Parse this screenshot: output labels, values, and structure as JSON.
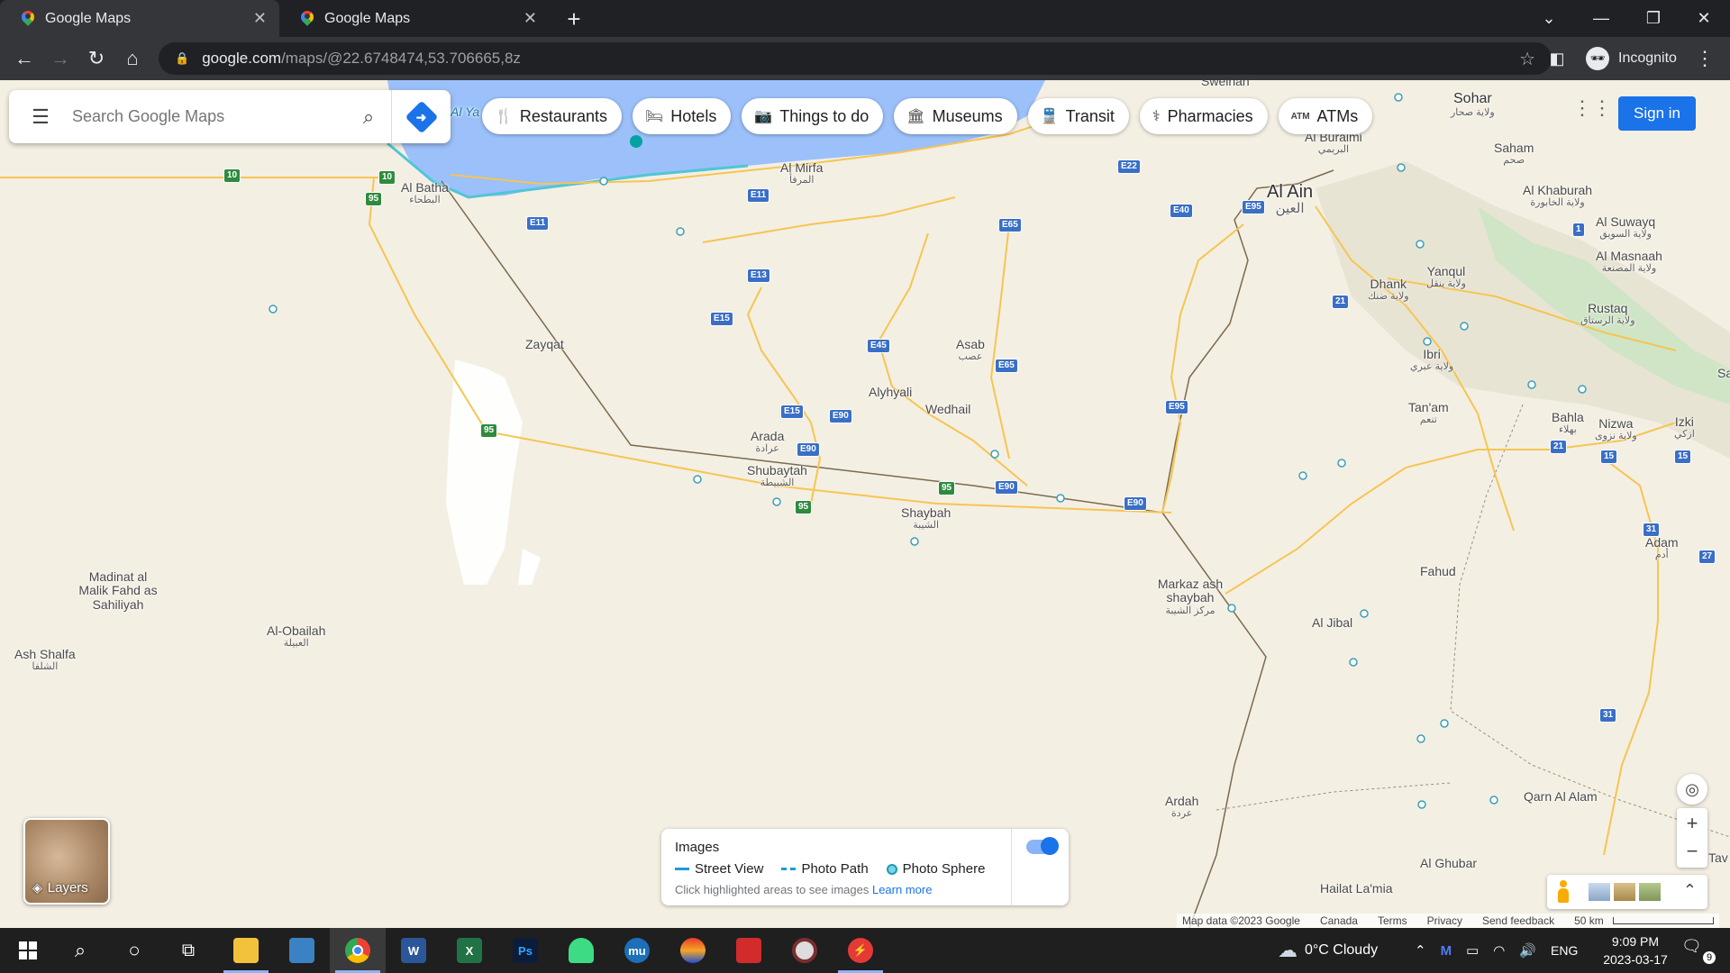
{
  "browser": {
    "tabs": [
      {
        "title": "Google Maps",
        "close": "✕"
      },
      {
        "title": "Google Maps",
        "close": "✕"
      }
    ],
    "new_tab": "+",
    "url_host": "google.com",
    "url_path": "/maps/@22.6748474,53.706665,8z",
    "profile_label": "Incognito"
  },
  "maps": {
    "search_placeholder": "Search Google Maps",
    "chips": [
      {
        "icon": "restaurant-icon",
        "label": "Restaurants"
      },
      {
        "icon": "hotel-icon",
        "label": "Hotels"
      },
      {
        "icon": "camera-icon",
        "label": "Things to do"
      },
      {
        "icon": "museum-icon",
        "label": "Museums"
      },
      {
        "icon": "transit-icon",
        "label": "Transit"
      },
      {
        "icon": "pharmacy-icon",
        "label": "Pharmacies"
      },
      {
        "icon": "atm-icon",
        "label": "ATMs"
      }
    ],
    "sign_in": "Sign in",
    "layers_label": "Layers",
    "images_panel": {
      "title": "Images",
      "legend": [
        "Street View",
        "Photo Path",
        "Photo Sphere"
      ],
      "hint": "Click highlighted areas to see images",
      "learn_more": "Learn more"
    },
    "attribution": [
      "Map data ©2023 Google",
      "Canada",
      "Terms",
      "Privacy",
      "Send feedback",
      "50 km"
    ],
    "places": [
      {
        "name": "Sweihan",
        "ar": ""
      },
      {
        "name": "Sohar",
        "ar": "ولاية صحار"
      },
      {
        "name": "Al Buraimi",
        "ar": "البريمي"
      },
      {
        "name": "Saham",
        "ar": "صحم"
      },
      {
        "name": "Al Mirfa",
        "ar": "المرفأ"
      },
      {
        "name": "Al Ain",
        "ar": "العين"
      },
      {
        "name": "Al Khaburah",
        "ar": "ولاية الخابورة"
      },
      {
        "name": "Al Suwayq",
        "ar": "ولاية السويق"
      },
      {
        "name": "Al Masnaah",
        "ar": "ولاية المصنعة"
      },
      {
        "name": "Al Batha",
        "ar": "البطحاء"
      },
      {
        "name": "Yanqul",
        "ar": "ولاية ينقل"
      },
      {
        "name": "Dhank",
        "ar": "ولاية ضنك"
      },
      {
        "name": "Rustaq",
        "ar": "ولاية الرستاق"
      },
      {
        "name": "Zayqat",
        "ar": ""
      },
      {
        "name": "Asab",
        "ar": "عصب"
      },
      {
        "name": "Ibri",
        "ar": "ولاية عبري"
      },
      {
        "name": "Alyhyali",
        "ar": ""
      },
      {
        "name": "Wedhail",
        "ar": ""
      },
      {
        "name": "Tan'am",
        "ar": "تنعم"
      },
      {
        "name": "Bahla",
        "ar": "بهلاء"
      },
      {
        "name": "Nizwa",
        "ar": "ولاية نزوى"
      },
      {
        "name": "Izki",
        "ar": "ازكي"
      },
      {
        "name": "Arada",
        "ar": "عرادة"
      },
      {
        "name": "Shubaytah",
        "ar": "الشبيطة"
      },
      {
        "name": "Shaybah",
        "ar": "الشيبة"
      },
      {
        "name": "Adam",
        "ar": "أدم"
      },
      {
        "name": "Fahud",
        "ar": ""
      },
      {
        "name": "Markaz ash shaybah",
        "ar": "مركز الشيبة"
      },
      {
        "name": "Madinat al Malik Fahd as Sahiliyah",
        "ar": ""
      },
      {
        "name": "Al Jibal",
        "ar": ""
      },
      {
        "name": "Al-Obailah",
        "ar": "العبيلة"
      },
      {
        "name": "Ash Shalfa",
        "ar": "الشلفا"
      },
      {
        "name": "Ardah",
        "ar": "عردة"
      },
      {
        "name": "Qarn Al Alam",
        "ar": ""
      },
      {
        "name": "Al Ghubar",
        "ar": ""
      },
      {
        "name": "Hailat La'mia",
        "ar": ""
      },
      {
        "name": "Al Ya",
        "ar": ""
      },
      {
        "name": "Sa",
        "ar": ""
      },
      {
        "name": "Tav",
        "ar": ""
      }
    ],
    "road_shields": [
      "10",
      "10",
      "95",
      "E11",
      "E11",
      "E22",
      "E40",
      "E95",
      "E65",
      "E13",
      "E15",
      "E45",
      "E65",
      "E15",
      "E90",
      "E90",
      "E95",
      "95",
      "95",
      "E90",
      "E90",
      "95",
      "21",
      "21",
      "1",
      "15",
      "15",
      "31",
      "27",
      "31"
    ]
  },
  "taskbar": {
    "weather": "0°C  Cloudy",
    "language": "ENG",
    "time": "9:09 PM",
    "date": "2023-03-17",
    "notifications": "9"
  }
}
